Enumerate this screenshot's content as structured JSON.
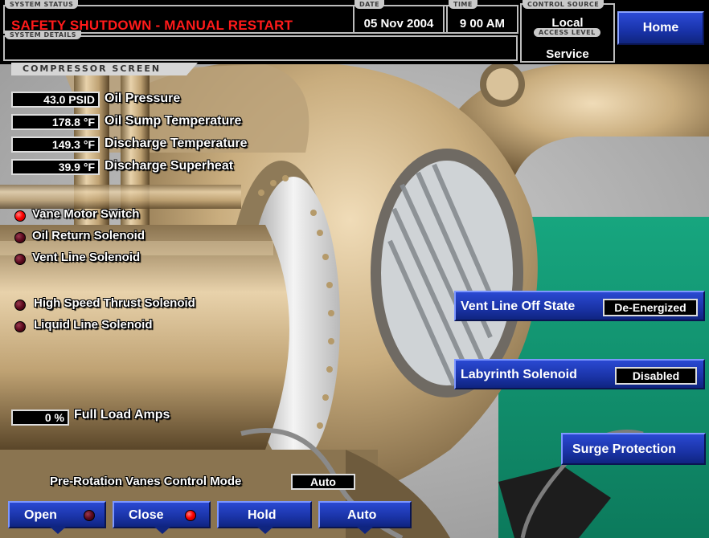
{
  "header": {
    "system_status_label": "SYSTEM STATUS",
    "system_status": "SAFETY SHUTDOWN - MANUAL RESTART",
    "system_details_label": "SYSTEM DETAILS",
    "system_details": "",
    "date_label": "DATE",
    "date": "05 Nov 2004",
    "time_label": "TIME",
    "time": "9 00 AM",
    "control_source_label": "CONTROL SOURCE",
    "control_source": "Local",
    "access_level_label": "ACCESS LEVEL",
    "access_level": "Service",
    "home_label": "Home"
  },
  "screen_title": "COMPRESSOR SCREEN",
  "readouts": [
    {
      "value": "43.0 PSID",
      "label": "Oil Pressure"
    },
    {
      "value": "178.8 °F",
      "label": "Oil Sump Temperature"
    },
    {
      "value": "149.3 °F",
      "label": "Discharge Temperature"
    },
    {
      "value": "39.9 °F",
      "label": "Discharge Superheat"
    }
  ],
  "indicators": [
    {
      "label": "Vane Motor Switch",
      "state": "on"
    },
    {
      "label": "Oil Return Solenoid",
      "state": "off"
    },
    {
      "label": "Vent Line Solenoid",
      "state": "off"
    },
    {
      "label": "High Speed Thrust Solenoid",
      "state": "off"
    },
    {
      "label": "Liquid Line Solenoid",
      "state": "off"
    }
  ],
  "full_load_amps": {
    "value": "0 %",
    "label": "Full Load Amps"
  },
  "vent_line_off_state": {
    "label": "Vent Line Off State",
    "value": "De-Energized"
  },
  "labyrinth_solenoid": {
    "label": "Labyrinth Solenoid",
    "value": "Disabled"
  },
  "surge_protection": {
    "label": "Surge Protection"
  },
  "prv_control_mode": {
    "label": "Pre-Rotation Vanes Control Mode",
    "value": "Auto"
  },
  "bottom_buttons": [
    {
      "label": "Open",
      "led": "off"
    },
    {
      "label": "Close",
      "led": "on"
    },
    {
      "label": "Hold"
    },
    {
      "label": "Auto"
    }
  ],
  "colors": {
    "status_red": "#ff1a1a",
    "button_blue": "#1a33a6",
    "floor_green": "#139c76",
    "machine_tan": "#c8ad80"
  }
}
